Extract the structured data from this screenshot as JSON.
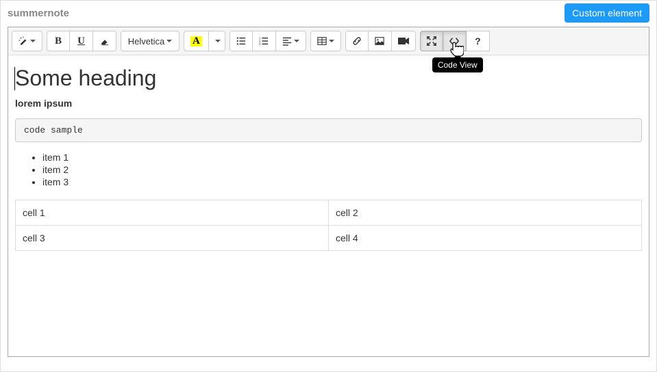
{
  "header": {
    "title": "summernote",
    "custom_button": "Custom element"
  },
  "toolbar": {
    "font_name": "Helvetica",
    "tooltip_codeview": "Code View"
  },
  "content": {
    "heading": "Some heading",
    "bold_line": "lorem ipsum",
    "code_sample": "code sample",
    "list": [
      "item 1",
      "item 2",
      "item 3"
    ],
    "table": [
      [
        "cell 1",
        "cell 2"
      ],
      [
        "cell 3",
        "cell 4"
      ]
    ]
  }
}
